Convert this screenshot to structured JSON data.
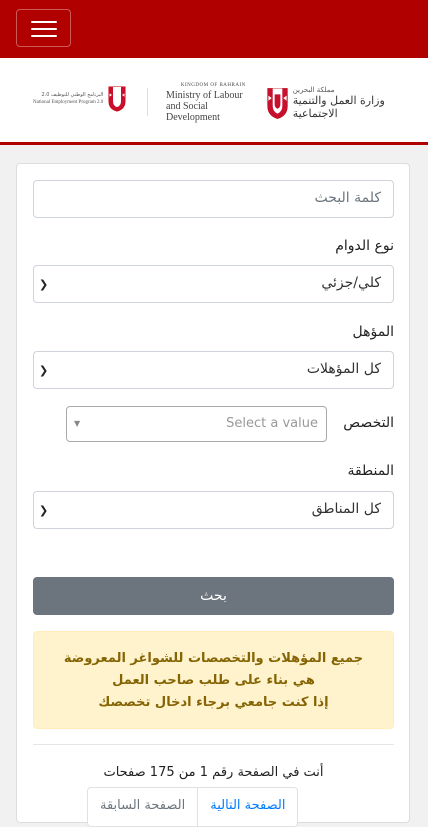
{
  "header": {
    "menu_icon": "hamburger-icon",
    "brand_color": "#b10000"
  },
  "logos": {
    "nep_arabic": "البرنامج الوطني للتوظيف 2.0",
    "nep_english": "National Employment Program 2.0",
    "kingdom": "KINGDOM OF BAHRAIN",
    "ministry_line1": "Ministry of Labour",
    "ministry_line2": "and Social Development",
    "ministry_ar_small": "مملكة البحرين",
    "ministry_ar_big": "وزارة العمل والتنمية الاجتماعية"
  },
  "form": {
    "keyword_placeholder": "كلمة البحث",
    "work_type_label": "نوع الدوام",
    "work_type_value": "كلي/جزئي",
    "qualification_label": "المؤهل",
    "qualification_value": "كل المؤهلات",
    "specialty_label": "التخصص",
    "specialty_placeholder": "Select a value",
    "region_label": "المنطقة",
    "region_value": "كل المناطق",
    "search_button": "بحث"
  },
  "alert": {
    "line1": "جميع المؤهلات والتخصصات للشواغر المعروضة",
    "line2": "هي بناء على طلب صاحب العمل",
    "line3": "إذا كنت جامعي برجاء ادخال تخصصك"
  },
  "pagination": {
    "info": "أنت في الصفحة رقم 1 من 175 صفحات",
    "prev": "الصفحة السابقة",
    "next": "الصفحة التالية"
  }
}
